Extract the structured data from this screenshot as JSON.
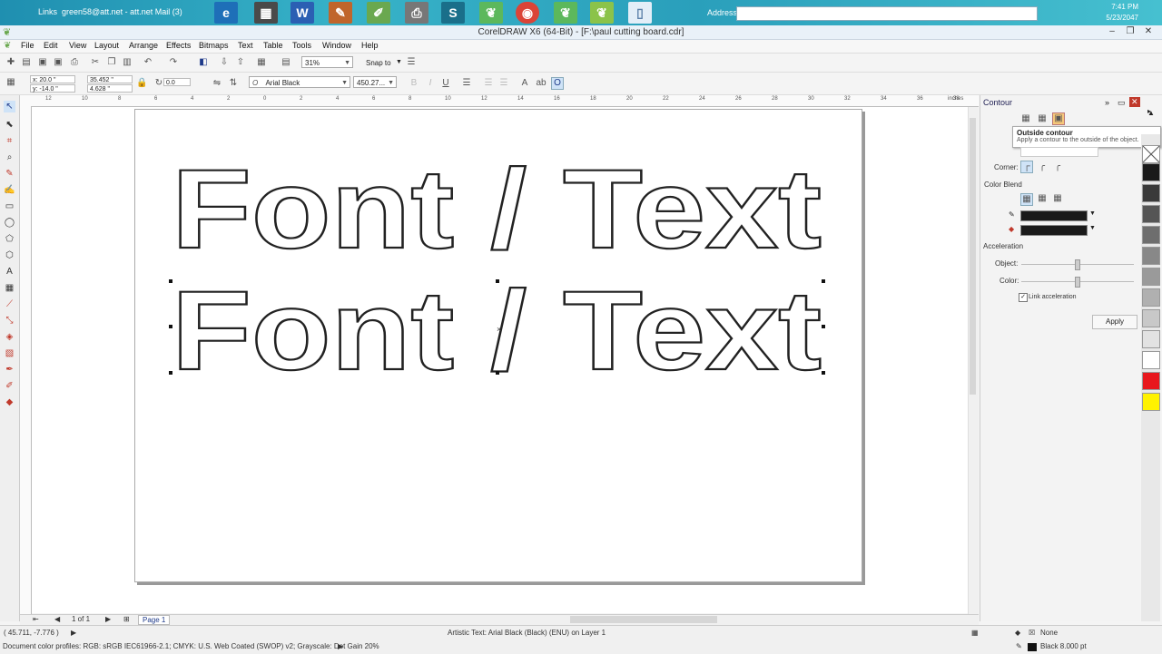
{
  "taskbar": {
    "links_label": "Links",
    "mail_label": "green58@att.net - att.net Mail (3)",
    "address_label": "Address",
    "clock_time": "7:41 PM",
    "clock_date": "5/23/2047",
    "app_icons": [
      "ie-icon",
      "calendar-icon",
      "word-icon",
      "paint-icon",
      "draw-icon",
      "printer-icon",
      "s-app-icon",
      "leaf-icon",
      "chrome-icon",
      "leaf2-icon",
      "leaf3-icon",
      "document-icon"
    ]
  },
  "window": {
    "title": "CorelDRAW X6 (64-Bit) - [F:\\paul cutting board.cdr]"
  },
  "menu": [
    "File",
    "Edit",
    "View",
    "Layout",
    "Arrange",
    "Effects",
    "Bitmaps",
    "Text",
    "Table",
    "Tools",
    "Window",
    "Help"
  ],
  "standard_toolbar": {
    "zoom": "31%",
    "snap_to": "Snap to"
  },
  "property_bar": {
    "x": "x: 20.0 \"",
    "y": "y: -14.0 \"",
    "width": "35.452 \"",
    "height": "4.628 \"",
    "angle": "0.0",
    "font_name": "Arial Black",
    "font_size": "450.27..."
  },
  "ruler": {
    "h_ticks": [
      "12",
      "10",
      "8",
      "6",
      "4",
      "2",
      "0",
      "2",
      "4",
      "6",
      "8",
      "10",
      "12",
      "14",
      "16",
      "18",
      "20",
      "22",
      "24",
      "26",
      "28",
      "30",
      "32",
      "34",
      "36",
      "38",
      "40"
    ],
    "unit": "inches"
  },
  "canvas": {
    "text_line_1": "Font / Text",
    "text_line_2": "Font / Text"
  },
  "docker": {
    "title": "Contour",
    "tooltip_title": "Outside contour",
    "tooltip_desc": "Apply a contour to the outside of the object.",
    "corner_label": "Corner:",
    "color_blend_label": "Color Blend",
    "acceleration_label": "Acceleration",
    "object_label": "Object:",
    "color_label": "Color:",
    "link_accel_label": "Link acceleration",
    "link_accel_checked": true,
    "apply_label": "Apply"
  },
  "palette": {
    "colors": [
      "#1a1a1a",
      "#3a3a3a",
      "#555555",
      "#6e6e6e",
      "#888888",
      "#9a9a9a",
      "#b0b0b0",
      "#c8c8c8",
      "#e2e2e2",
      "#ffffff",
      "#e8171d",
      "#fff200"
    ]
  },
  "page_nav": {
    "page_count": "1 of 1",
    "page_tab": "Page 1"
  },
  "status": {
    "coords": "( 45.711, -7.776 )",
    "object_info": "Artistic Text: Arial Black (Black) (ENU) on Layer 1",
    "color_profiles": "Document color profiles: RGB: sRGB IEC61966-2.1; CMYK: U.S. Web Coated (SWOP) v2; Grayscale: Dot Gain 20%",
    "fill_label": "None",
    "outline_label": "Black  8.000 pt"
  }
}
